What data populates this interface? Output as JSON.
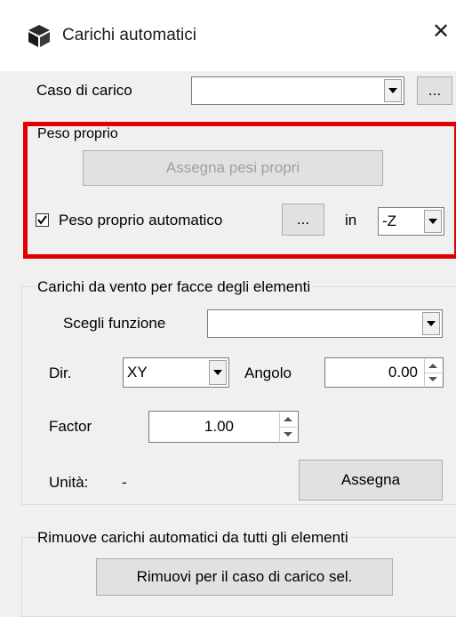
{
  "window": {
    "title": "Carichi automatici",
    "app_icon": "cube-icon",
    "close_glyph": "✕"
  },
  "load_case": {
    "label": "Caso di carico",
    "value": "",
    "browse_label": "..."
  },
  "self_weight": {
    "group_title": "Peso proprio",
    "assign_label": "Assegna pesi propri",
    "auto_checked": true,
    "auto_label": "Peso proprio automatico",
    "browse_label": "...",
    "in_label": "in",
    "direction": "-Z",
    "highlight_color": "#e00000"
  },
  "wind": {
    "group_title": "Carichi da vento per facce degli elementi",
    "function_label": "Scegli funzione",
    "function_value": "",
    "dir_label": "Dir.",
    "dir_value": "XY",
    "angle_label": "Angolo",
    "angle_value": "0.00",
    "factor_label": "Factor",
    "factor_value": "1.00",
    "units_label": "Unità:",
    "units_value": "-",
    "assign_label": "Assegna"
  },
  "remove": {
    "group_title": "Rimuove carichi automatici da tutti gli elementi",
    "button_label": "Rimuovi per il caso di carico sel."
  }
}
